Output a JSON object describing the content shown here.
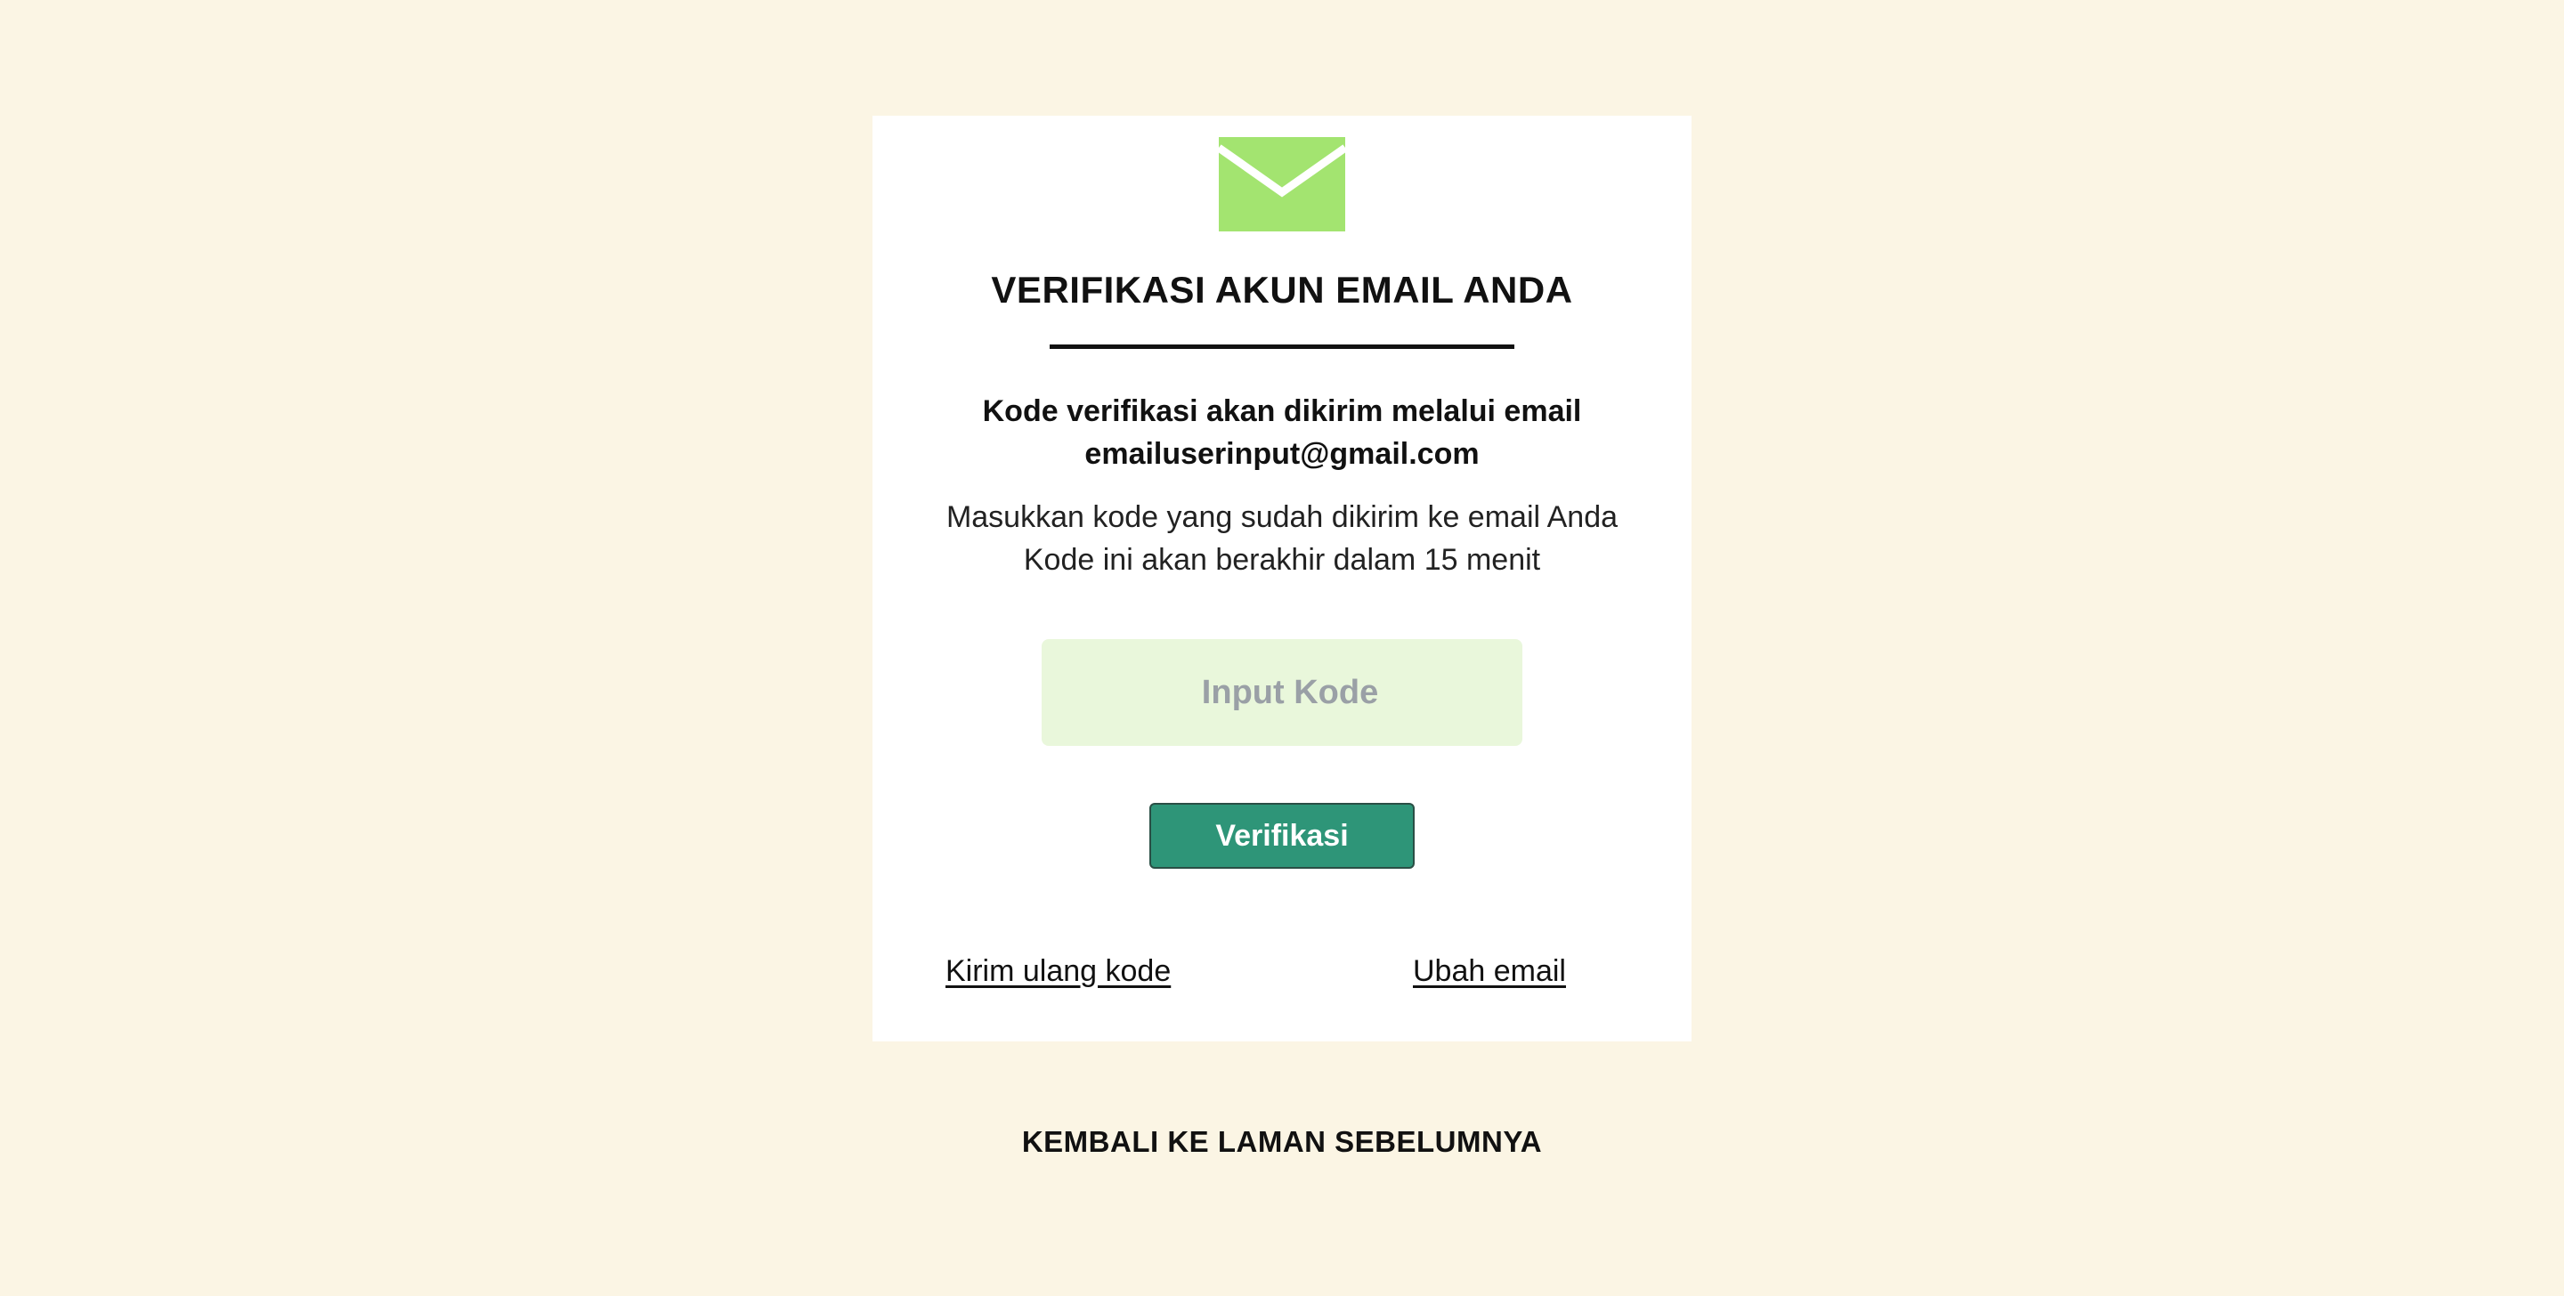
{
  "colors": {
    "page_background": "#fbf5e4",
    "card_background": "#ffffff",
    "envelope": "#a3e470",
    "input_background": "#e9f7db",
    "button_background": "#2e9578",
    "text": "#111111"
  },
  "card": {
    "icon": "envelope-icon",
    "title": "VERIFIKASI AKUN EMAIL ANDA",
    "info_line_1": "Kode verifikasi akan dikirim melalui email",
    "info_email": "emailuserinput@gmail.com",
    "instruction_line_1": "Masukkan kode yang sudah dikirim ke email Anda",
    "instruction_line_2": "Kode ini akan berakhir dalam 15 menit",
    "code_input": {
      "placeholder": "Input Kode",
      "value": ""
    },
    "verify_button_label": "Verifikasi",
    "resend_link_label": "Kirim ulang kode",
    "change_email_link_label": "Ubah email"
  },
  "back_link_label": "KEMBALI KE LAMAN SEBELUMNYA"
}
